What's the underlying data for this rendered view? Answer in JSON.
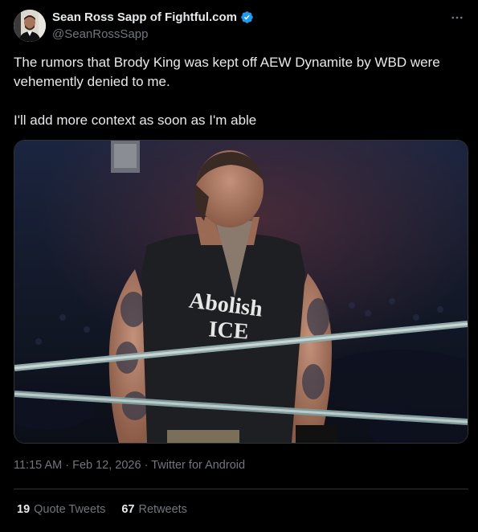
{
  "author": {
    "display_name": "Sean Ross Sapp of Fightful.com",
    "handle": "@SeanRossSapp",
    "verified_color": "#1d9bf0",
    "avatar_icon": "avatar-photo"
  },
  "tweet": {
    "paragraphs": [
      "The rumors that Brody King was kept off AEW Dynamite by WBD were vehemently denied to me.",
      "I'll add more context as soon as I'm able"
    ],
    "media": {
      "shirt_text_line1": "Abolish",
      "shirt_text_line2": "ICE"
    }
  },
  "meta": {
    "time": "11:15 AM",
    "date": "Feb 12, 2026",
    "source": "Twitter for Android",
    "separator": " · "
  },
  "stats": [
    {
      "count": "19",
      "label": "Quote Tweets"
    },
    {
      "count": "67",
      "label": "Retweets"
    }
  ],
  "icons": {
    "more": "more-icon",
    "verified": "verified-badge-icon"
  },
  "colors": {
    "background": "#000000",
    "text": "#e7e9ea",
    "secondary": "#71767b",
    "border": "#2f3336",
    "accent": "#1d9bf0"
  }
}
